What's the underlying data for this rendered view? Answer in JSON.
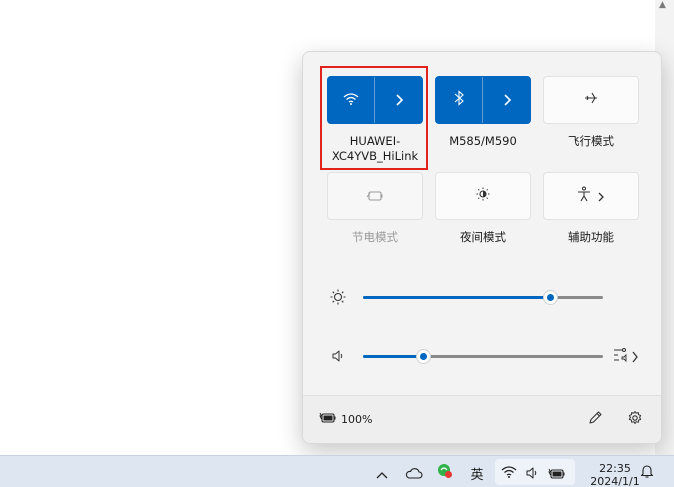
{
  "quick_settings": {
    "tiles": [
      {
        "label": "HUAWEI-XC4YVB_HiLink",
        "label_line1": "HUAWEI-",
        "label_line2": "XC4YVB_HiLink",
        "icon": "wifi-icon",
        "state": "on",
        "highlighted": true
      },
      {
        "label": "M585/M590",
        "icon": "bluetooth-icon",
        "state": "on"
      },
      {
        "label": "飞行模式",
        "icon": "airplane-icon",
        "state": "off"
      },
      {
        "label": "节电模式",
        "icon": "battery-saver-icon",
        "state": "disabled"
      },
      {
        "label": "夜间模式",
        "icon": "night-light-icon",
        "state": "off"
      },
      {
        "label": "辅助功能",
        "icon": "accessibility-icon",
        "state": "off"
      }
    ],
    "brightness": {
      "icon": "sun-icon",
      "level_percent": 78
    },
    "volume": {
      "icon": "speaker-icon",
      "level_percent": 25,
      "mixer_icon": "audio-mixer-icon"
    },
    "footer": {
      "battery_percent": "100%",
      "battery_icon": "battery-charging-icon",
      "edit_icon": "pencil-icon",
      "settings_icon": "gear-icon"
    }
  },
  "taskbar": {
    "tray_icons": [
      "chevron-up-icon",
      "onedrive-cloud-icon",
      "app-tray-icon"
    ],
    "ime_label": "英",
    "status_icons": [
      "wifi-icon",
      "speaker-icon",
      "battery-charging-icon"
    ],
    "time": "22:35",
    "date": "2024/1/1",
    "notification_icon": "bell-icon"
  },
  "colors": {
    "accent": "#0067c0",
    "highlight_box": "#e0241b",
    "panel_bg": "#f3f3f3",
    "taskbar_bg": "#dde6f1"
  }
}
